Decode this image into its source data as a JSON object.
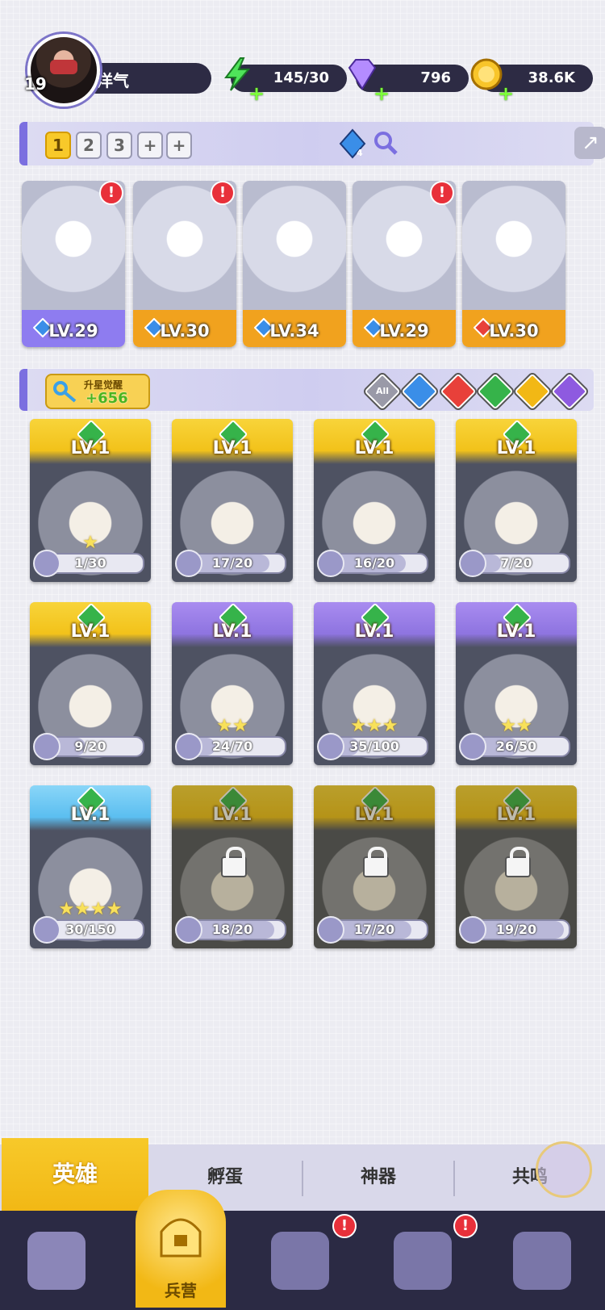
{
  "player": {
    "level": "19",
    "name": "洋气"
  },
  "resources": {
    "energy": "145/30",
    "gems": "796",
    "coins": "38.6K"
  },
  "team_tabs": [
    "1",
    "2",
    "3",
    "+",
    "+"
  ],
  "team_gem_count": "4",
  "team": [
    {
      "level": "LV.29",
      "element_color": "#3a8ee8",
      "alert": true,
      "tone": "#8e7cf0"
    },
    {
      "level": "LV.30",
      "element_color": "#3a8ee8",
      "alert": true,
      "tone": "#f1a21e"
    },
    {
      "level": "LV.34",
      "element_color": "#3a8ee8",
      "alert": false,
      "tone": "#f1a21e"
    },
    {
      "level": "LV.29",
      "element_color": "#3a8ee8",
      "alert": true,
      "tone": "#f1a21e"
    },
    {
      "level": "LV.30",
      "element_color": "#e8403a",
      "alert": false,
      "tone": "#f1a21e"
    }
  ],
  "awaken": {
    "label": "升星觉醒",
    "value": "+656"
  },
  "element_filters": [
    {
      "label": "All",
      "color": "#9a9aa8"
    },
    {
      "label": "",
      "color": "#3a8ee8"
    },
    {
      "label": "",
      "color": "#e8403a"
    },
    {
      "label": "",
      "color": "#36b34a"
    },
    {
      "label": "",
      "color": "#f2b815"
    },
    {
      "label": "",
      "color": "#8e5ae0"
    }
  ],
  "heroes": [
    {
      "level": "LV.1",
      "progress": "1/30",
      "fill": 0.03,
      "stars": "★",
      "tone": "gold",
      "locked": false
    },
    {
      "level": "LV.1",
      "progress": "17/20",
      "fill": 0.85,
      "stars": "",
      "tone": "gold",
      "locked": false
    },
    {
      "level": "LV.1",
      "progress": "16/20",
      "fill": 0.8,
      "stars": "",
      "tone": "gold",
      "locked": false
    },
    {
      "level": "LV.1",
      "progress": "7/20",
      "fill": 0.35,
      "stars": "",
      "tone": "gold",
      "locked": false
    },
    {
      "level": "LV.1",
      "progress": "9/20",
      "fill": 0.45,
      "stars": "",
      "tone": "gold",
      "locked": false
    },
    {
      "level": "LV.1",
      "progress": "24/70",
      "fill": 0.34,
      "stars": "★★",
      "tone": "purple",
      "locked": false
    },
    {
      "level": "LV.1",
      "progress": "35/100",
      "fill": 0.35,
      "stars": "★★★",
      "tone": "purple",
      "locked": false
    },
    {
      "level": "LV.1",
      "progress": "26/50",
      "fill": 0.52,
      "stars": "★★",
      "tone": "purple",
      "locked": false
    },
    {
      "level": "LV.1",
      "progress": "30/150",
      "fill": 0.2,
      "stars": "★★★★",
      "tone": "blue",
      "locked": false
    },
    {
      "level": "LV.1",
      "progress": "18/20",
      "fill": 0.9,
      "stars": "",
      "tone": "gold",
      "locked": true
    },
    {
      "level": "LV.1",
      "progress": "17/20",
      "fill": 0.85,
      "stars": "",
      "tone": "gold",
      "locked": true
    },
    {
      "level": "LV.1",
      "progress": "19/20",
      "fill": 0.95,
      "stars": "",
      "tone": "gold",
      "locked": true
    }
  ],
  "subtabs": [
    "英雄",
    "孵蛋",
    "神器",
    "共鸣"
  ],
  "nav": {
    "active_label": "兵营"
  }
}
